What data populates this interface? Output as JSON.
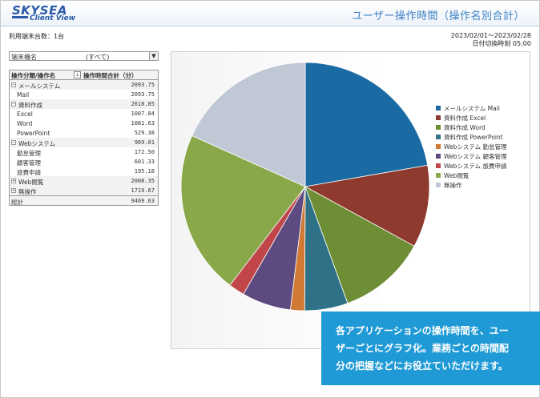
{
  "header": {
    "logo_main": "SKYSEA",
    "logo_sub": "Client View",
    "title": "ユーザー操作時間（操作名別合計）"
  },
  "info": {
    "terminal_count": "利用端末台数：1台",
    "date_range": "2023/02/01～2023/02/28",
    "day_switch": "日付切換時刻 05:00"
  },
  "filter": {
    "label": "端末機名",
    "value": "(すべて)",
    "arrow": "▼"
  },
  "table": {
    "col1": "操作分類/操作名",
    "col2": "操作時間合計（分）",
    "sorter": "↓",
    "rows": [
      {
        "name": "メールシステム",
        "value": "2093.75",
        "level": 0,
        "toggle": "−"
      },
      {
        "name": "Mail",
        "value": "2093.75",
        "level": 1
      },
      {
        "name": "資料作成",
        "value": "2618.85",
        "level": 0,
        "toggle": "−"
      },
      {
        "name": "Excel",
        "value": "1007.84",
        "level": 1
      },
      {
        "name": "Word",
        "value": "1081.63",
        "level": 1
      },
      {
        "name": "PowerPoint",
        "value": "529.38",
        "level": 1
      },
      {
        "name": "Webシステム",
        "value": "969.01",
        "level": 0,
        "toggle": "−"
      },
      {
        "name": "勤怠管理",
        "value": "172.50",
        "level": 1
      },
      {
        "name": "顧客管理",
        "value": "601.33",
        "level": 1
      },
      {
        "name": "旅費申請",
        "value": "195.18",
        "level": 1
      },
      {
        "name": "Web閲覧",
        "value": "2008.35",
        "level": 0,
        "toggle": "+"
      },
      {
        "name": "無操作",
        "value": "1719.67",
        "level": 0,
        "toggle": "+"
      }
    ],
    "total_label": "総計",
    "total_value": "9409.63"
  },
  "chart_data": {
    "type": "pie",
    "series": [
      {
        "name": "メールシステム Mail",
        "value": 2093.75,
        "color": "#1a6aa3"
      },
      {
        "name": "資料作成 Excel",
        "value": 1007.84,
        "color": "#8e3a2e"
      },
      {
        "name": "資料作成 Word",
        "value": 1081.63,
        "color": "#6e8e36"
      },
      {
        "name": "資料作成 PowerPoint",
        "value": 529.38,
        "color": "#2f7288"
      },
      {
        "name": "Webシステム 勤怠管理",
        "value": 172.5,
        "color": "#d07a35"
      },
      {
        "name": "Webシステム 顧客管理",
        "value": 601.33,
        "color": "#5c4a80"
      },
      {
        "name": "Webシステム 旅費申請",
        "value": 195.18,
        "color": "#c0464a"
      },
      {
        "name": "Web閲覧",
        "value": 2008.35,
        "color": "#89a84a"
      },
      {
        "name": "無操作",
        "value": 1719.67,
        "color": "#c0c8d6"
      }
    ],
    "legend_position": "right"
  },
  "callout": {
    "line1": "各アプリケーションの操作時間を、ユー",
    "line2": "ザーごとにグラフ化。業務ごとの時間配",
    "line3": "分の把握などにお役立ていただけます。"
  }
}
